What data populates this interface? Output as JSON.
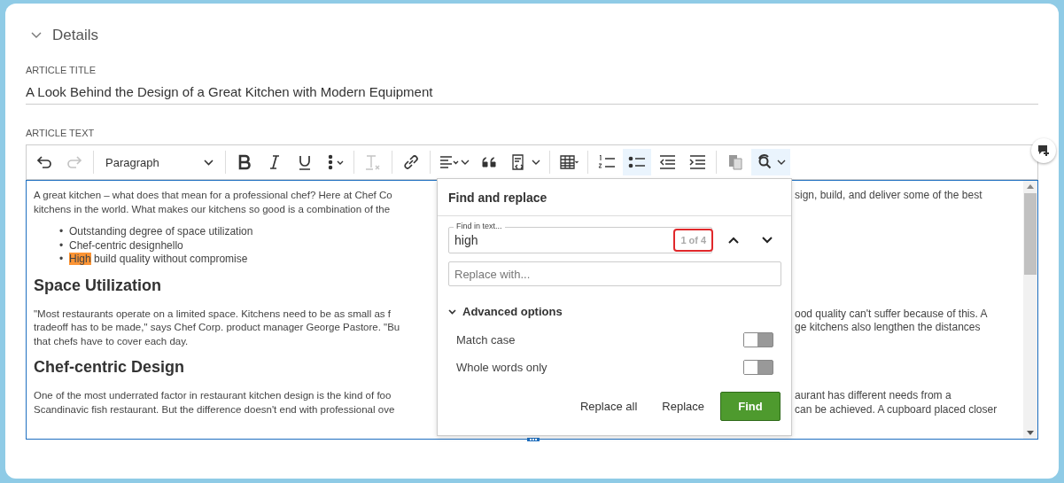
{
  "section": {
    "title": "Details",
    "expanded": true
  },
  "article_title": {
    "label": "ARTICLE TITLE",
    "value": "A Look Behind the Design of a Great Kitchen with Modern Equipment"
  },
  "article_text": {
    "label": "ARTICLE TEXT"
  },
  "toolbar": [
    {
      "kind": "undo",
      "disabled": false,
      "on": false
    },
    {
      "kind": "redo",
      "disabled": true,
      "on": false
    },
    {
      "kind": "sep"
    },
    {
      "kind": "heading",
      "label": "Paragraph",
      "disabled": false,
      "on": false
    },
    {
      "kind": "sep"
    },
    {
      "kind": "bold",
      "disabled": false,
      "on": false
    },
    {
      "kind": "italic",
      "disabled": false,
      "on": false
    },
    {
      "kind": "underline",
      "disabled": false,
      "on": false
    },
    {
      "kind": "more",
      "disabled": false,
      "on": false
    },
    {
      "kind": "sep"
    },
    {
      "kind": "clear-format",
      "disabled": true,
      "on": false
    },
    {
      "kind": "sep"
    },
    {
      "kind": "link",
      "disabled": false,
      "on": false
    },
    {
      "kind": "sep"
    },
    {
      "kind": "align",
      "disabled": false,
      "on": false
    },
    {
      "kind": "quote",
      "disabled": false,
      "on": false
    },
    {
      "kind": "source",
      "disabled": false,
      "on": false
    },
    {
      "kind": "sep"
    },
    {
      "kind": "table",
      "disabled": false,
      "on": false
    },
    {
      "kind": "sep"
    },
    {
      "kind": "numbered-list",
      "disabled": false,
      "on": false
    },
    {
      "kind": "bulleted-list",
      "disabled": false,
      "on": true
    },
    {
      "kind": "outdent",
      "disabled": false,
      "on": false
    },
    {
      "kind": "indent",
      "disabled": false,
      "on": false
    },
    {
      "kind": "sep"
    },
    {
      "kind": "paste",
      "disabled": false,
      "on": false
    },
    {
      "kind": "find",
      "disabled": false,
      "on": true
    }
  ],
  "content": [
    {
      "kind": "paragraph",
      "lines": [
        {
          "left": "A great kitchen – what does that mean for a professional chef? Here at Chef Co",
          "right": "sign, build, and deliver some of the best"
        },
        {
          "left": "kitchens in the world. What makes our kitchens so good is a combination of the"
        }
      ]
    },
    {
      "kind": "list",
      "items": [
        {
          "marker": "•",
          "segments": [
            {
              "text": "Outstanding degree of space utilization",
              "highlighted": false
            }
          ]
        },
        {
          "marker": "•",
          "segments": [
            {
              "text": "Chef-centric designhello",
              "highlighted": false
            }
          ]
        },
        {
          "marker": "•",
          "segments": [
            {
              "text": "High",
              "highlighted": true
            },
            {
              "text": " build quality without compromise",
              "highlighted": false
            }
          ]
        }
      ]
    },
    {
      "kind": "heading",
      "text": "Space Utilization"
    },
    {
      "kind": "paragraph",
      "lines": [
        {
          "left": "\"Most restaurants operate on a limited space. Kitchens need to be as small as f",
          "right": "ood quality can't suffer because of this. A"
        },
        {
          "left": "tradeoff has to be made,\" says Chef Corp. product manager George Pastore. \"Bu",
          "right": "ge kitchens also lengthen the distances"
        },
        {
          "left": "that chefs have to cover each day."
        }
      ]
    },
    {
      "kind": "heading",
      "text": "Chef-centric Design"
    },
    {
      "kind": "paragraph",
      "lines": [
        {
          "left": "One of the most underrated factor in restaurant kitchen design is the kind of foo",
          "right": "aurant has different needs from a"
        },
        {
          "left": "Scandinavic fish restaurant. But the difference doesn't end with professional ove",
          "right": "can be achieved. A cupboard placed closer"
        }
      ]
    }
  ],
  "find_replace": {
    "title": "Find and replace",
    "find_field": {
      "label": "Find in text...",
      "value": "high",
      "counter": "1 of 4"
    },
    "replace_field": {
      "placeholder": "Replace with..."
    },
    "advanced": {
      "label": "Advanced options",
      "expanded": true
    },
    "options": [
      {
        "label": "Match case",
        "on": false
      },
      {
        "label": "Whole words only",
        "on": false
      }
    ],
    "buttons": [
      {
        "label": "Replace all",
        "kind": "plain"
      },
      {
        "label": "Replace",
        "kind": "plain"
      },
      {
        "label": "Find",
        "kind": "primary"
      }
    ]
  }
}
